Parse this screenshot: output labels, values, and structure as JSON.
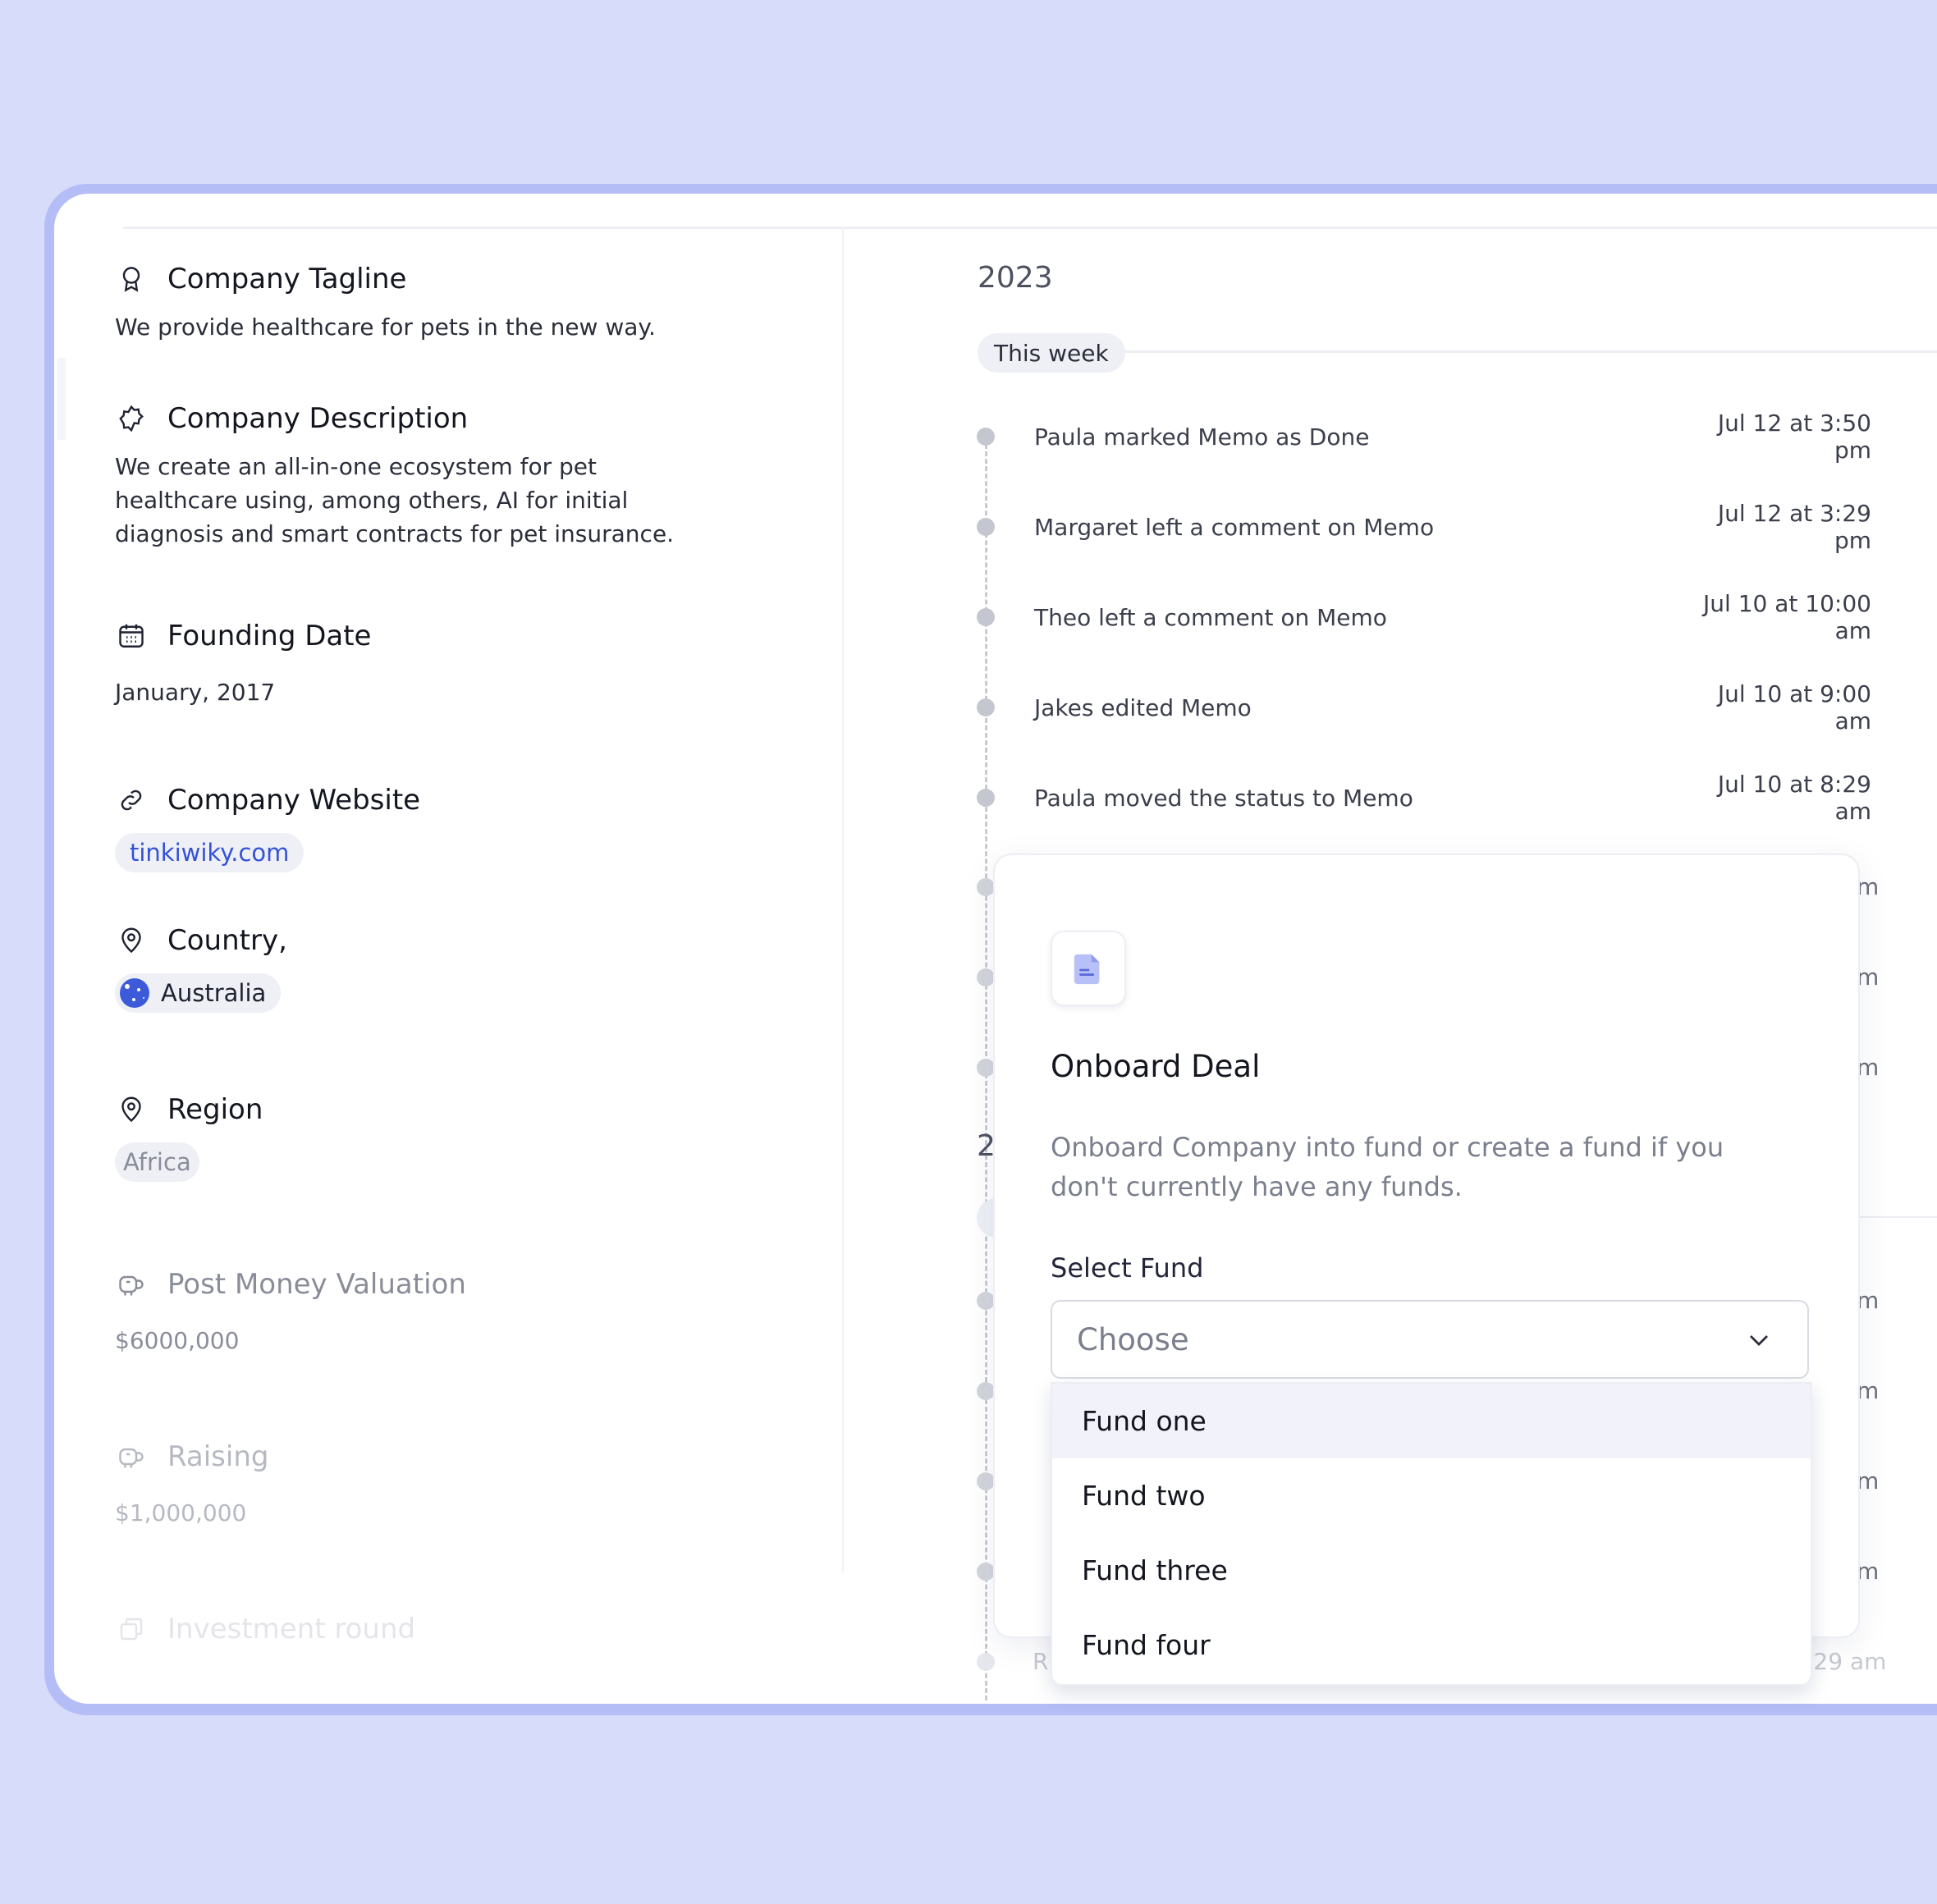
{
  "company": {
    "tagline": {
      "title": "Company Tagline",
      "value": "We provide healthcare for pets in the new way."
    },
    "description": {
      "title": "Company Description",
      "value": "We create an all-in-one ecosystem for pet healthcare using, among others, AI for initial diagnosis and smart contracts for pet insurance."
    },
    "founding": {
      "title": "Founding Date",
      "value": "January, 2017"
    },
    "website": {
      "title": "Company Website",
      "value": "tinkiwiky.com"
    },
    "country": {
      "title": "Country,",
      "value": "Australia"
    },
    "region": {
      "title": "Region",
      "value": "Africa"
    },
    "valuation": {
      "title": "Post Money Valuation",
      "value": "$6000,000"
    },
    "raising": {
      "title": "Raising",
      "value": "$1,000,000"
    },
    "round": {
      "title": "Investment round"
    }
  },
  "timeline": {
    "year": "2023",
    "period": "This week",
    "items": [
      {
        "text": "Paula marked Memo as Done",
        "time": "Jul 12 at 3:50 pm"
      },
      {
        "text": "Margaret left a comment on Memo",
        "time": "Jul 12 at 3:29 pm"
      },
      {
        "text": "Theo left a comment on Memo",
        "time": "Jul 10 at 10:00 am"
      },
      {
        "text": "Jakes edited Memo",
        "time": "Jul 10 at 9:00 am"
      },
      {
        "text": "Paula moved the status to Memo",
        "time": "Jul 10 at 8:29 am"
      }
    ],
    "ghost_suffix": "m",
    "ghost_year_digit": "2",
    "ghost_last_prefix": "R",
    "ghost_last_time": ":29 am"
  },
  "modal": {
    "title": "Onboard Deal",
    "description": "Onboard Company into fund or create a fund if you don't currently have any funds.",
    "select_label": "Select Fund",
    "select_placeholder": "Choose",
    "options": [
      "Fund one",
      "Fund two",
      "Fund three",
      "Fund four"
    ]
  },
  "colors": {
    "accent": "#3552d6",
    "background": "#d8dcfb",
    "frame": "#b4bdf5"
  }
}
